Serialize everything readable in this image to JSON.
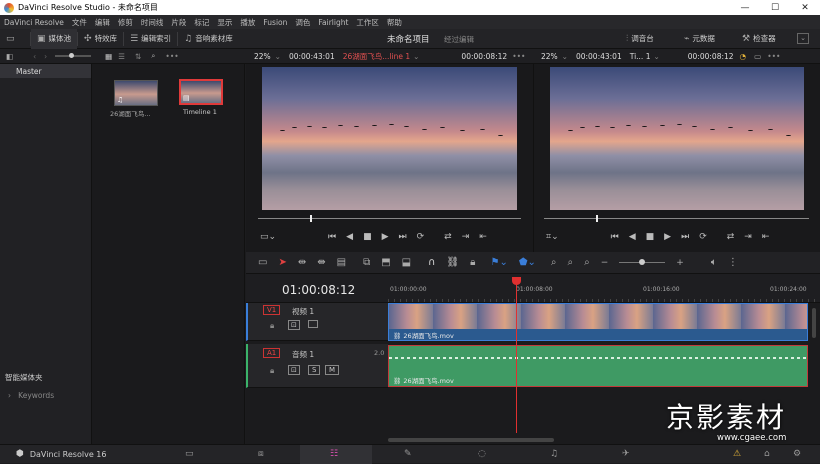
{
  "window": {
    "title": "DaVinci Resolve Studio - 未命名项目",
    "minimize": "—",
    "maximize": "☐",
    "close": "✕"
  },
  "menu": [
    "DaVinci Resolve",
    "文件",
    "编辑",
    "修剪",
    "时间线",
    "片段",
    "标记",
    "显示",
    "播放",
    "Fusion",
    "调色",
    "Fairlight",
    "工作区",
    "帮助"
  ],
  "toolbar": {
    "media_pool": "媒体池",
    "effects": "特效库",
    "edit_index": "编辑索引",
    "sound_library": "音响素材库",
    "project_name": "未命名项目",
    "edited": "经过编辑",
    "mixer": "调音台",
    "metadata": "元数据",
    "inspector": "检查器"
  },
  "source_viewer": {
    "zoom": "22%",
    "timecode": "00:00:43:01",
    "clip_name": "26湖面飞鸟...line 1",
    "position": "00:00:08:12"
  },
  "timeline_viewer": {
    "zoom": "22%",
    "timecode": "00:00:43:01",
    "name": "Ti... 1",
    "position": "00:00:08:12"
  },
  "bin": {
    "master": "Master",
    "smart_bins": "智能媒体夹",
    "keywords": "Keywords",
    "items": [
      {
        "label": "26湖面飞鸟..."
      },
      {
        "label": "Timeline 1"
      }
    ]
  },
  "timeline": {
    "timecode": "01:00:08:12",
    "ruler": [
      "01:00:00:00",
      "01:00:08:00",
      "01:00:16:00",
      "01:00:24:00"
    ],
    "video_track": {
      "id": "V1",
      "name": "视频 1",
      "clip": "26湖面飞鸟.mov"
    },
    "audio_track": {
      "id": "A1",
      "name": "音频 1",
      "level": "2.0",
      "clip": "26湖面飞鸟.mov",
      "solo": "S",
      "mute": "M"
    }
  },
  "bottom": {
    "app": "DaVinci Resolve 16"
  },
  "watermark": {
    "text": "京影素材",
    "url": "www.cgaee.com"
  }
}
